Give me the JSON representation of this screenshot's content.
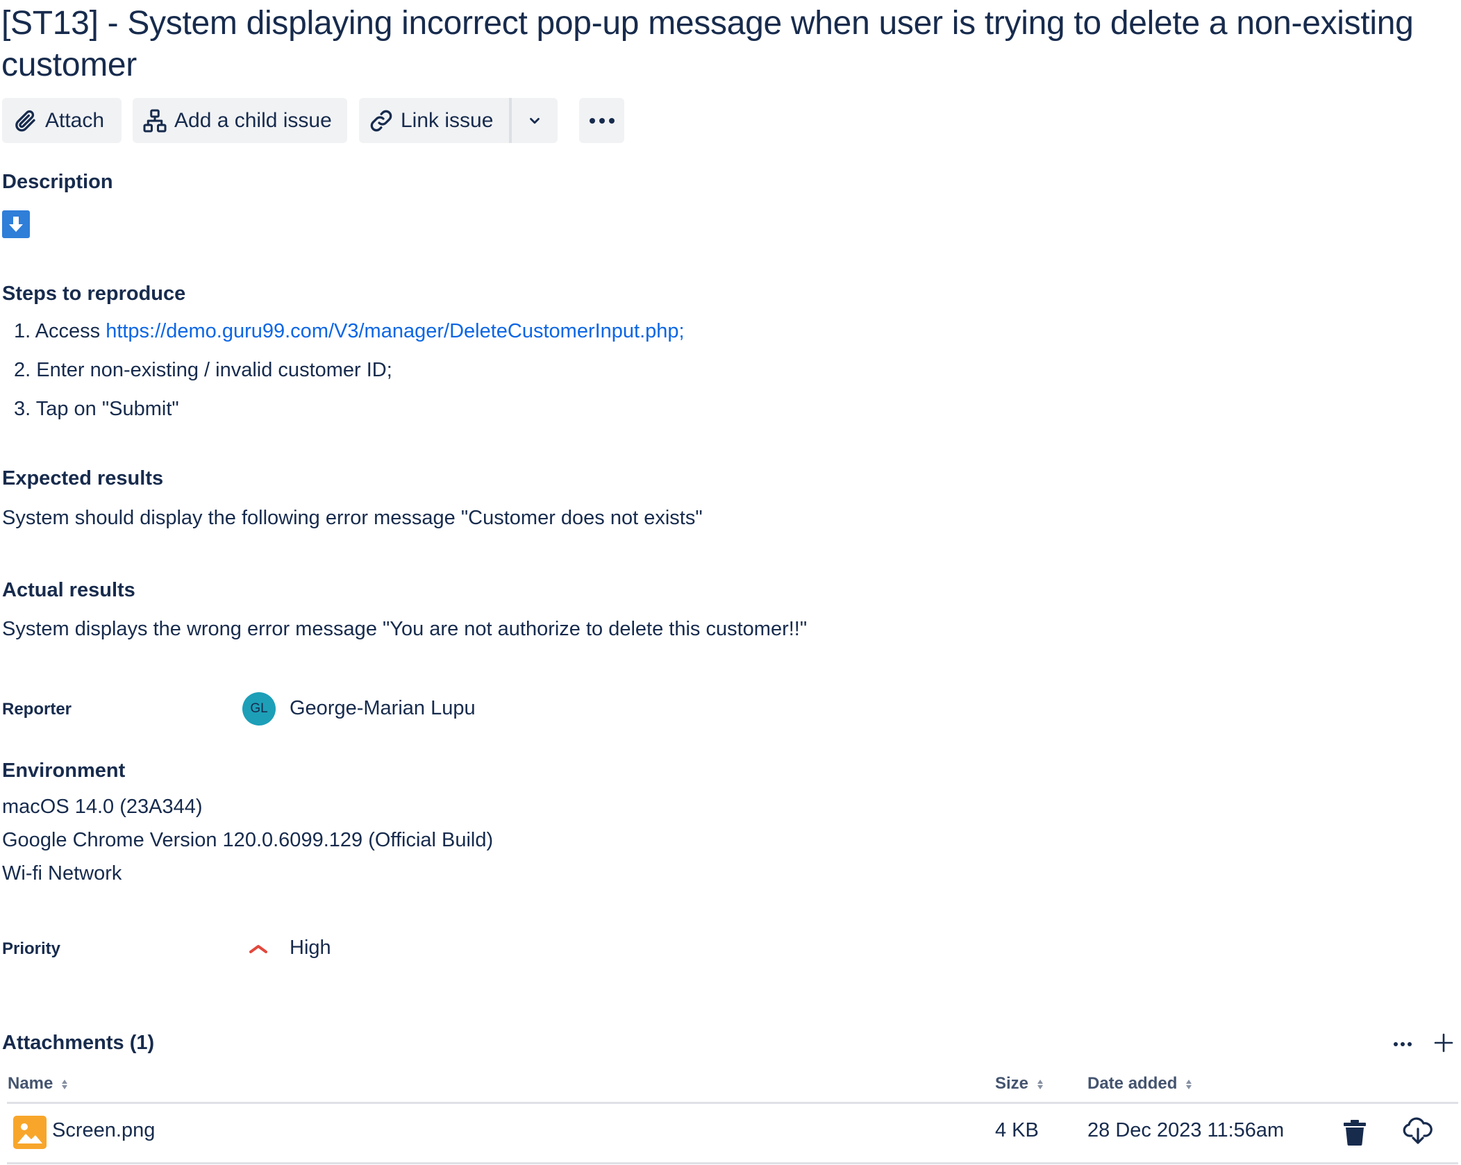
{
  "issue": {
    "title": "[ST13] - System displaying incorrect pop-up message when user is trying to delete a non-existing customer"
  },
  "toolbar": {
    "attach_label": "Attach",
    "add_child_label": "Add a child issue",
    "link_issue_label": "Link issue"
  },
  "description": {
    "heading": "Description",
    "steps_heading": "Steps to reproduce",
    "steps": [
      {
        "num": "1.",
        "prefix": "Access ",
        "link": "https://demo.guru99.com/V3/manager/DeleteCustomerInput.php;"
      },
      {
        "num": "2.",
        "text": "Enter non-existing / invalid customer ID;"
      },
      {
        "num": "3.",
        "text": "Tap on \"Submit\""
      }
    ],
    "expected_heading": "Expected results",
    "expected_text": "System should display the following error message \"Customer does not exists\"",
    "actual_heading": "Actual results",
    "actual_text": "System displays the wrong error message \"You are not authorize to delete this customer!!\""
  },
  "reporter": {
    "label": "Reporter",
    "initials": "GL",
    "name": "George-Marian Lupu",
    "avatar_color": "#1d9fb8"
  },
  "environment": {
    "heading": "Environment",
    "lines": [
      "macOS 14.0 (23A344)",
      "Google Chrome Version 120.0.6099.129 (Official Build)",
      "Wi-fi Network"
    ]
  },
  "priority": {
    "label": "Priority",
    "value": "High",
    "color": "#e2483d"
  },
  "attachments": {
    "heading": "Attachments (1)",
    "columns": {
      "name": "Name",
      "size": "Size",
      "date": "Date added"
    },
    "rows": [
      {
        "name": "Screen.png",
        "size": "4 KB",
        "date": "28 Dec 2023 11:56am",
        "icon": "image-file-icon",
        "icon_color": "#f8a62b"
      }
    ]
  },
  "colors": {
    "text": "#172b4d",
    "link": "#0c66e4",
    "button_bg": "#f1f2f4",
    "expand_icon_bg": "#2f7ed8"
  }
}
